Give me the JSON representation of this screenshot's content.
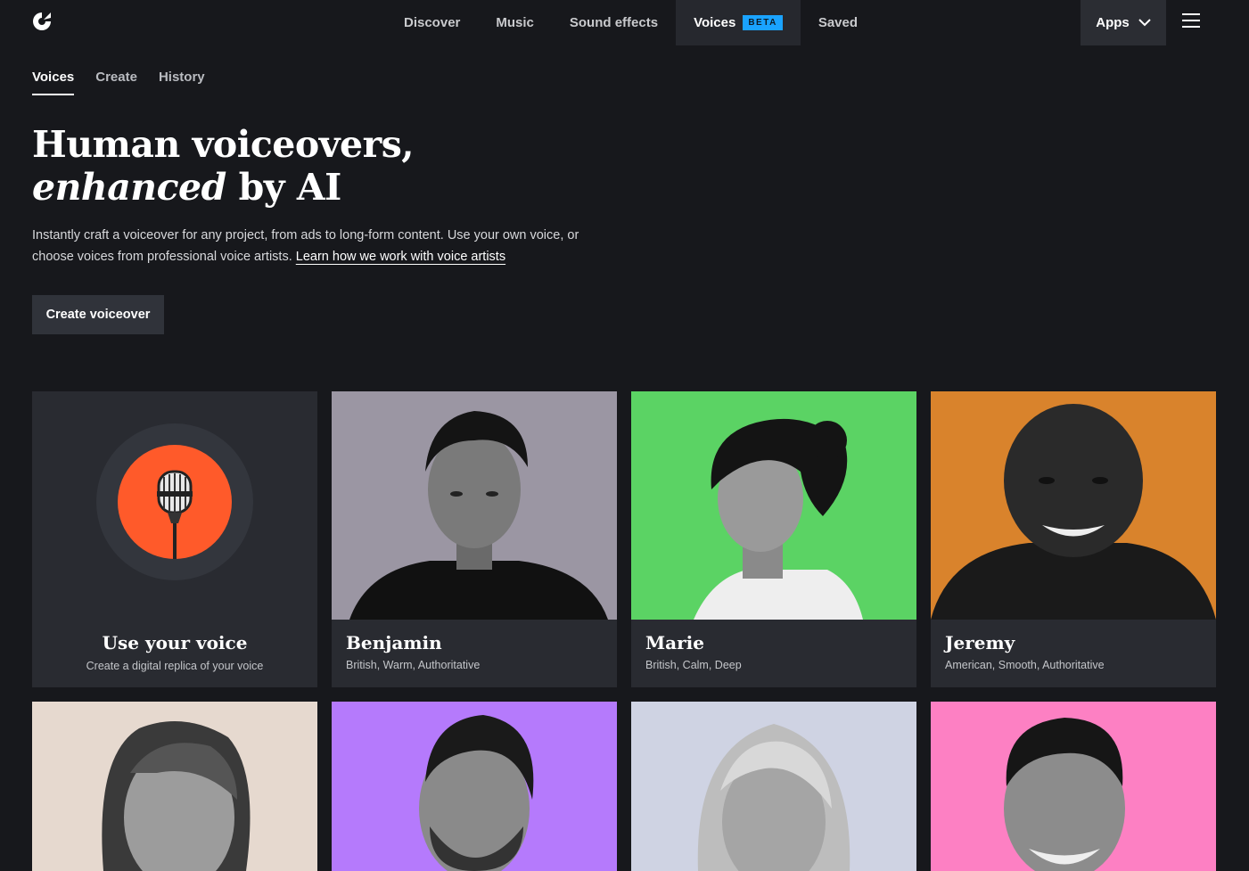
{
  "nav": {
    "items": [
      {
        "label": "Discover"
      },
      {
        "label": "Music"
      },
      {
        "label": "Sound effects"
      },
      {
        "label": "Voices",
        "badge": "BETA",
        "active": true
      },
      {
        "label": "Saved"
      }
    ],
    "apps_label": "Apps"
  },
  "subtabs": [
    {
      "label": "Voices",
      "active": true
    },
    {
      "label": "Create"
    },
    {
      "label": "History"
    }
  ],
  "hero": {
    "title_line1": "Human voiceovers,",
    "title_em": "enhanced",
    "title_rest": " by AI",
    "description": "Instantly craft a voiceover for any project, from ads to long-form content. Use your own voice, or choose voices from professional voice artists. ",
    "link_text": "Learn how we work with voice artists",
    "cta_label": "Create voiceover"
  },
  "own_voice": {
    "title": "Use your voice",
    "subtitle": "Create a digital replica of your voice",
    "icon": "microphone-icon"
  },
  "voices": [
    {
      "name": "Benjamin",
      "tags": "British, Warm, Authoritative",
      "bg": "#9b96a3"
    },
    {
      "name": "Marie",
      "tags": "British, Calm, Deep",
      "bg": "#5bd364"
    },
    {
      "name": "Jeremy",
      "tags": "American, Smooth, Authoritative",
      "bg": "#d9832c"
    },
    {
      "name": "",
      "tags": "",
      "bg": "#e6d9cf"
    },
    {
      "name": "",
      "tags": "",
      "bg": "#b57afc"
    },
    {
      "name": "",
      "tags": "",
      "bg": "#cfd3e3"
    },
    {
      "name": "",
      "tags": "",
      "bg": "#fd80c3"
    }
  ],
  "colors": {
    "background": "#17181c",
    "card": "#292b31",
    "accent_beta": "#1aa3ff",
    "mic_accent": "#ff5a2a"
  }
}
